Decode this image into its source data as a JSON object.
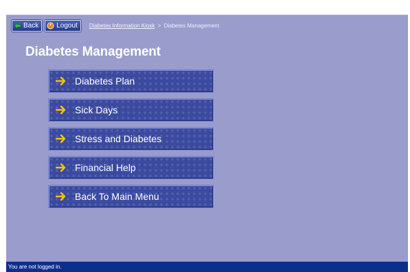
{
  "toolbar": {
    "back_label": "Back",
    "logout_label": "Logout"
  },
  "breadcrumb": {
    "link": "Diabetes Information Kiosk",
    "separator": ">",
    "current": "Diabetes Management"
  },
  "page": {
    "title": "Diabetes Management"
  },
  "menu": {
    "items": [
      {
        "label": "Diabetes Plan",
        "icon": "arrow-right-icon"
      },
      {
        "label": "Sick Days",
        "icon": "arrow-right-icon"
      },
      {
        "label": "Stress and Diabetes",
        "icon": "arrow-right-icon"
      },
      {
        "label": "Financial Help",
        "icon": "arrow-right-icon"
      },
      {
        "label": "Back To Main Menu",
        "icon": "arrow-right-icon"
      }
    ]
  },
  "status": {
    "text": "You are not logged in."
  },
  "colors": {
    "panel": "#9a9ccc",
    "button": "#3b4a9f",
    "arrow": "#f5c400",
    "statusbar": "#0c2f8e"
  }
}
